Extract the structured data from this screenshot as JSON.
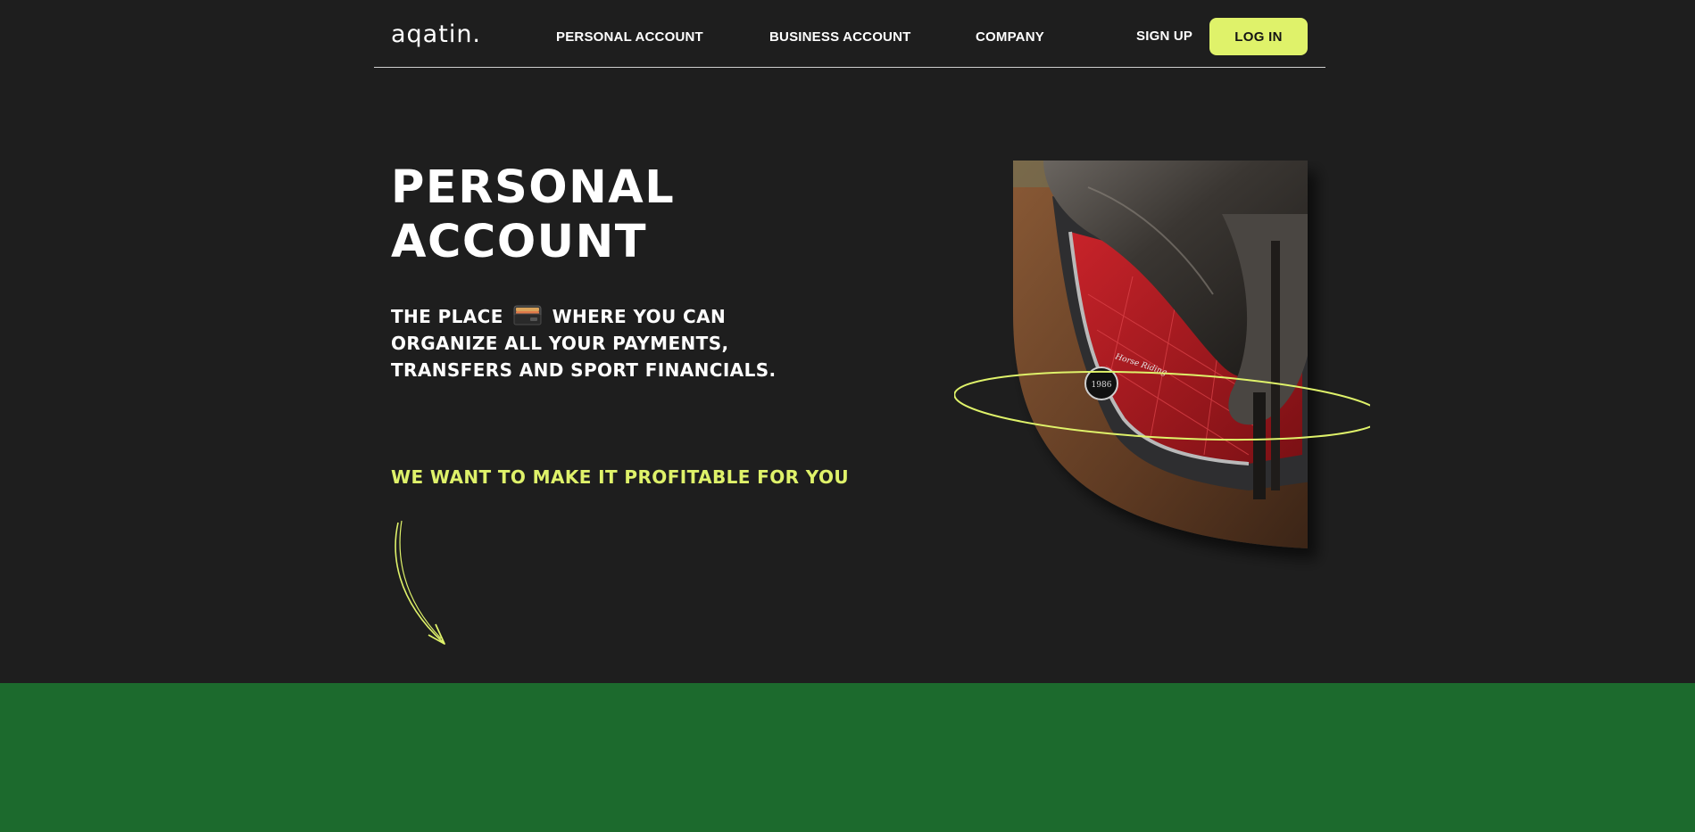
{
  "header": {
    "logo": "aqatin.",
    "nav": {
      "personal": "PERSONAL ACCOUNT",
      "business": "BUSINESS ACCOUNT",
      "company": "COMPANY"
    },
    "signup_label": "SIGN UP",
    "login_label": "LOG IN"
  },
  "hero": {
    "title_line1": "PERSONAL",
    "title_line2": "ACCOUNT",
    "subtitle_line1_a": "THE PLACE",
    "subtitle_line1_b": "WHERE YOU CAN",
    "subtitle_line2": "ORGANIZE ALL YOUR PAYMENTS,",
    "subtitle_line3": "TRANSFERS AND SPORT FINANCIALS.",
    "tagline": "WE WANT TO MAKE IT PROFITABLE FOR YOU",
    "photo_badge_text": "1986",
    "photo_script_text": "Horse Riding"
  },
  "icons": {
    "wallet": "wallet-icon",
    "arrow": "curved-arrow-down-icon"
  },
  "colors": {
    "background": "#1e1e1e",
    "accent": "#dff26a",
    "band": "#1c6a2d"
  }
}
